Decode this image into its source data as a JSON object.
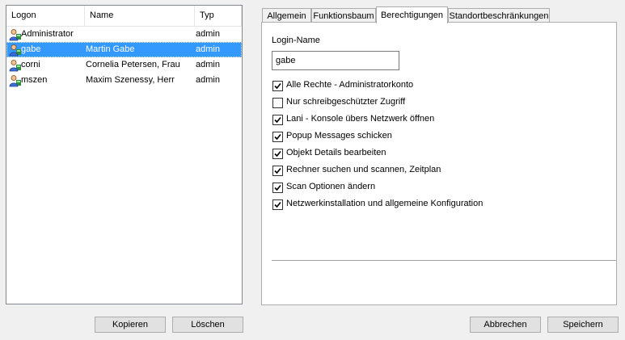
{
  "users_list": {
    "columns": [
      "Logon",
      "Name",
      "Typ"
    ],
    "rows": [
      {
        "logon": "Administrator",
        "name": "",
        "typ": "admin",
        "selected": false
      },
      {
        "logon": "gabe",
        "name": "Martin Gabe",
        "typ": "admin",
        "selected": true
      },
      {
        "logon": "corni",
        "name": "Cornelia Petersen, Frau",
        "typ": "admin",
        "selected": false
      },
      {
        "logon": "mszen",
        "name": "Maxim Szenessy, Herr",
        "typ": "admin",
        "selected": false
      }
    ]
  },
  "tabs": [
    "Allgemein",
    "Funktionsbaum",
    "Berechtigungen",
    "Standortbeschränkungen"
  ],
  "active_tab": "Berechtigungen",
  "login": {
    "label": "Login-Name",
    "value": "gabe"
  },
  "permissions": [
    {
      "label": "Alle Rechte - Administratorkonto",
      "checked": true
    },
    {
      "label": "Nur schreibgeschützter Zugriff",
      "checked": false
    },
    {
      "label": "Lani - Konsole übers Netzwerk öffnen",
      "checked": true
    },
    {
      "label": "Popup Messages schicken",
      "checked": true
    },
    {
      "label": "Objekt Details bearbeiten",
      "checked": true
    },
    {
      "label": "Rechner suchen und scannen, Zeitplan",
      "checked": true
    },
    {
      "label": "Scan Optionen ändern",
      "checked": true
    },
    {
      "label": "Netzwerkinstallation und allgemeine Konfiguration",
      "checked": true
    }
  ],
  "buttons": {
    "copy": "Kopieren",
    "delete": "Löschen",
    "cancel": "Abbrechen",
    "save": "Speichern"
  },
  "colors": {
    "selection": "#3399ff",
    "window_bg": "#f0f0f0"
  }
}
